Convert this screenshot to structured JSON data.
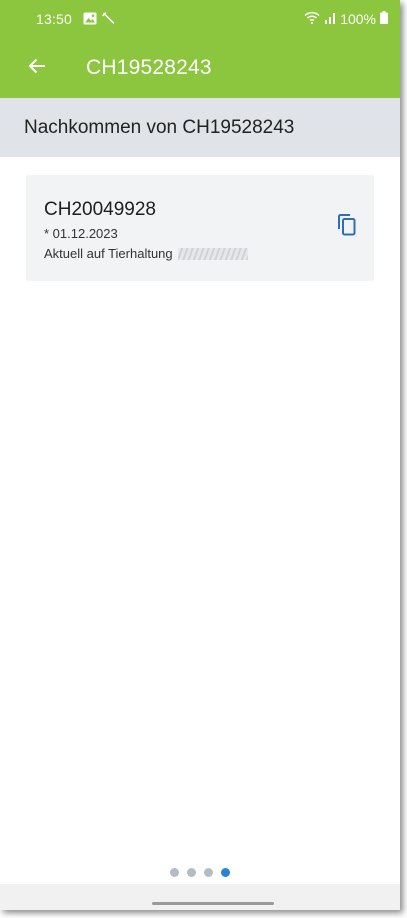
{
  "status_bar": {
    "time": "13:50",
    "battery": "100%",
    "icons": [
      "image-icon",
      "wrench-icon",
      "wifi-icon",
      "signal-icon",
      "battery-icon"
    ]
  },
  "app_bar": {
    "title": "CH19528243",
    "back_icon": "arrow-left-icon",
    "background_color": "#8cc63f"
  },
  "sub_header": {
    "title": "Nachkommen von CH19528243"
  },
  "offspring_list": [
    {
      "id": "CH20049928",
      "date": "* 01.12.2023",
      "location_label": "Aktuell auf Tierhaltung",
      "action_icon": "copy-icon"
    }
  ],
  "pager": {
    "total": 4,
    "active_index": 3,
    "active_color": "#2d82d6"
  }
}
